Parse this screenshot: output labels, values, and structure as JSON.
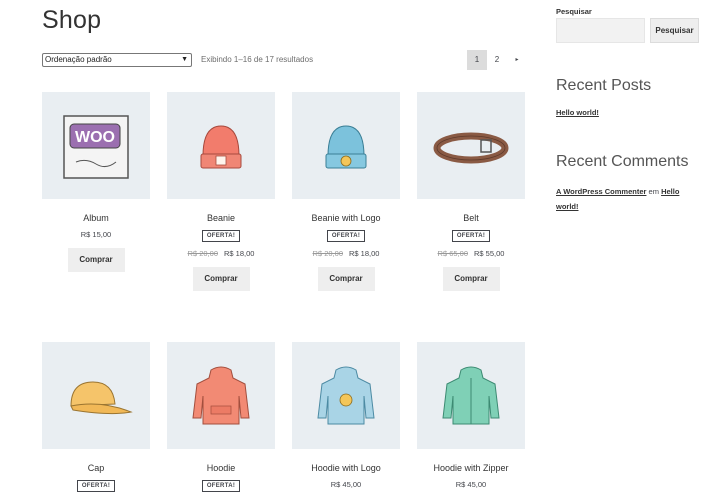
{
  "page": {
    "title": "Shop"
  },
  "toolbar": {
    "orderby_value": "Ordenação padrão",
    "result_count": "Exibindo 1–16 de 17 resultados",
    "pages": [
      "1",
      "2"
    ],
    "next_icon": "▸"
  },
  "products": [
    {
      "name": "Album",
      "badge": "",
      "old_price": "",
      "price": "R$ 15,00",
      "button": "Comprar",
      "icon": "album-cover-icon"
    },
    {
      "name": "Beanie",
      "badge": "OFERTA!",
      "old_price": "R$ 20,00",
      "price": "R$ 18,00",
      "button": "Comprar",
      "icon": "beanie-icon"
    },
    {
      "name": "Beanie with Logo",
      "badge": "OFERTA!",
      "old_price": "R$ 20,00",
      "price": "R$ 18,00",
      "button": "Comprar",
      "icon": "beanie-logo-icon"
    },
    {
      "name": "Belt",
      "badge": "OFERTA!",
      "old_price": "R$ 65,00",
      "price": "R$ 55,00",
      "button": "Comprar",
      "icon": "belt-icon"
    },
    {
      "name": "Cap",
      "badge": "OFERTA!",
      "icon": "cap-icon"
    },
    {
      "name": "Hoodie",
      "badge": "OFERTA!",
      "icon": "hoodie-icon"
    },
    {
      "name": "Hoodie with Logo",
      "price": "R$ 45,00",
      "icon": "hoodie-logo-icon"
    },
    {
      "name": "Hoodie with Zipper",
      "price": "R$ 45,00",
      "icon": "hoodie-zipper-icon"
    }
  ],
  "sidebar": {
    "search_label": "Pesquisar",
    "search_placeholder": "",
    "search_button": "Pesquisar",
    "recent_posts_title": "Recent Posts",
    "recent_post": "Hello world!",
    "recent_comments_title": "Recent Comments",
    "comment_author": "A WordPress Commenter",
    "comment_sep": "em",
    "comment_post": "Hello world!"
  },
  "colors": {
    "thumb_bg": "#e9eef2",
    "button_bg": "#eeeeee",
    "text": "#43454b"
  }
}
